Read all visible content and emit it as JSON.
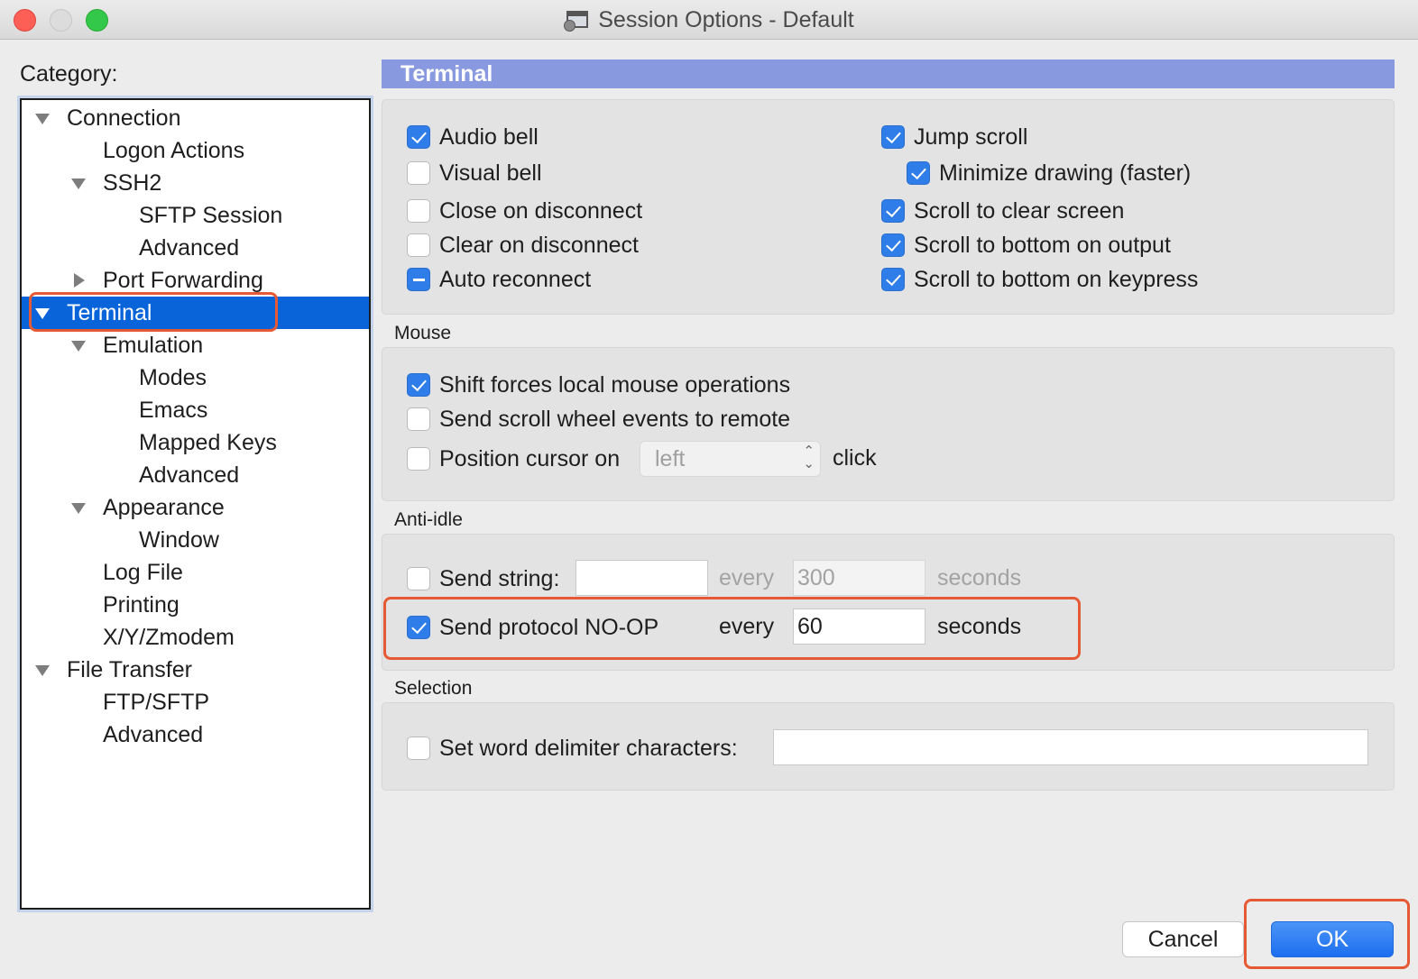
{
  "window": {
    "title": "Session Options - Default"
  },
  "category": {
    "label": "Category:",
    "items": [
      {
        "label": "Connection",
        "level": 0,
        "expander": "down",
        "selected": false
      },
      {
        "label": "Logon Actions",
        "level": 1,
        "expander": "none",
        "selected": false
      },
      {
        "label": "SSH2",
        "level": 1,
        "expander": "down",
        "selected": false
      },
      {
        "label": "SFTP Session",
        "level": 2,
        "expander": "none",
        "selected": false
      },
      {
        "label": "Advanced",
        "level": 2,
        "expander": "none",
        "selected": false
      },
      {
        "label": "Port Forwarding",
        "level": 1,
        "expander": "right",
        "selected": false
      },
      {
        "label": "Terminal",
        "level": 0,
        "expander": "down",
        "selected": true
      },
      {
        "label": "Emulation",
        "level": 1,
        "expander": "down",
        "selected": false
      },
      {
        "label": "Modes",
        "level": 2,
        "expander": "none",
        "selected": false
      },
      {
        "label": "Emacs",
        "level": 2,
        "expander": "none",
        "selected": false
      },
      {
        "label": "Mapped Keys",
        "level": 2,
        "expander": "none",
        "selected": false
      },
      {
        "label": "Advanced",
        "level": 2,
        "expander": "none",
        "selected": false
      },
      {
        "label": "Appearance",
        "level": 1,
        "expander": "down",
        "selected": false
      },
      {
        "label": "Window",
        "level": 2,
        "expander": "none",
        "selected": false
      },
      {
        "label": "Log File",
        "level": 1,
        "expander": "none",
        "selected": false
      },
      {
        "label": "Printing",
        "level": 1,
        "expander": "none",
        "selected": false
      },
      {
        "label": "X/Y/Zmodem",
        "level": 1,
        "expander": "none",
        "selected": false
      },
      {
        "label": "File Transfer",
        "level": 0,
        "expander": "down",
        "selected": false
      },
      {
        "label": "FTP/SFTP",
        "level": 1,
        "expander": "none",
        "selected": false
      },
      {
        "label": "Advanced",
        "level": 1,
        "expander": "none",
        "selected": false
      }
    ]
  },
  "panel": {
    "header": "Terminal",
    "general": {
      "audio_bell": {
        "label": "Audio bell",
        "checked": true
      },
      "visual_bell": {
        "label": "Visual bell",
        "checked": false
      },
      "close_on_disconnect": {
        "label": "Close on disconnect",
        "checked": false
      },
      "clear_on_disconnect": {
        "label": "Clear on disconnect",
        "checked": false
      },
      "auto_reconnect": {
        "label": "Auto reconnect",
        "state": "mixed"
      },
      "jump_scroll": {
        "label": "Jump scroll",
        "checked": true
      },
      "minimize_drawing": {
        "label": "Minimize drawing (faster)",
        "checked": true
      },
      "scroll_clear": {
        "label": "Scroll to clear screen",
        "checked": true
      },
      "scroll_output": {
        "label": "Scroll to bottom on output",
        "checked": true
      },
      "scroll_keypress": {
        "label": "Scroll to bottom on keypress",
        "checked": true
      }
    },
    "mouse": {
      "title": "Mouse",
      "shift_forces": {
        "label": "Shift forces local mouse operations",
        "checked": true
      },
      "send_scroll": {
        "label": "Send scroll wheel events to remote",
        "checked": false
      },
      "position_cursor": {
        "label": "Position cursor on",
        "checked": false
      },
      "position_select": "left",
      "position_suffix": "click"
    },
    "anti_idle": {
      "title": "Anti-idle",
      "send_string": {
        "label": "Send string:",
        "checked": false,
        "value": ""
      },
      "send_string_every": "every",
      "send_string_seconds_value": "300",
      "send_string_seconds": "seconds",
      "noop": {
        "label": "Send protocol NO-OP",
        "checked": true
      },
      "noop_every": "every",
      "noop_seconds_value": "60",
      "noop_seconds": "seconds"
    },
    "selection": {
      "title": "Selection",
      "word_delim": {
        "label": "Set word delimiter characters:",
        "checked": false,
        "value": ""
      }
    }
  },
  "buttons": {
    "cancel": "Cancel",
    "ok": "OK"
  },
  "colors": {
    "accent": "#0a64d9",
    "header": "#8899e0",
    "highlight": "#e55a35",
    "checkbox_on": "#2f7de9"
  }
}
